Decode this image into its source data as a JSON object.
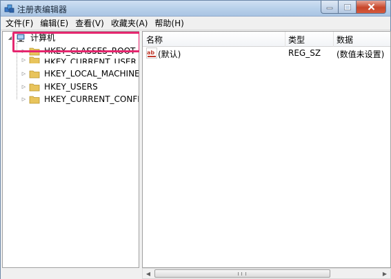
{
  "window": {
    "title": "注册表编辑器"
  },
  "menu": {
    "items": [
      "文件(F)",
      "编辑(E)",
      "查看(V)",
      "收藏夹(A)",
      "帮助(H)"
    ]
  },
  "tree": {
    "root": "计算机",
    "items": [
      {
        "label": "HKEY_CLASSES_ROOT"
      },
      {
        "label": "HKEY_CURRENT_USER"
      },
      {
        "label": "HKEY_LOCAL_MACHINE"
      },
      {
        "label": "HKEY_USERS"
      },
      {
        "label": "HKEY_CURRENT_CONFIG"
      }
    ]
  },
  "list": {
    "columns": [
      "名称",
      "类型",
      "数据"
    ],
    "rows": [
      {
        "name": "(默认)",
        "type": "REG_SZ",
        "data": "(数值未设置)"
      }
    ]
  },
  "colors": {
    "highlight": "#e5266e",
    "folder": "#e8c45c"
  }
}
